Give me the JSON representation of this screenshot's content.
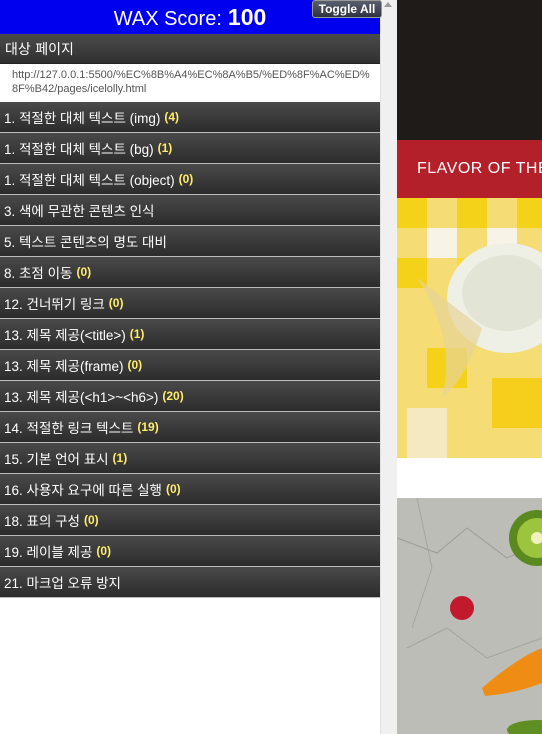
{
  "header": {
    "title": "WAX Score:",
    "score": "100"
  },
  "toggle_label": "Toggle All",
  "target": {
    "label": "대상 페이지",
    "url": "http://127.0.0.1:5500/%EC%8B%A4%EC%8A%B5/%ED%8F%AC%ED%8F%B42/pages/icelolly.html"
  },
  "items": [
    {
      "label": "1. 적절한 대체 텍스트 (img)",
      "count": "(4)"
    },
    {
      "label": "1. 적절한 대체 텍스트 (bg)",
      "count": "(1)"
    },
    {
      "label": "1. 적절한 대체 텍스트 (object)",
      "count": "(0)"
    },
    {
      "label": "3. 색에 무관한 콘텐츠 인식",
      "count": ""
    },
    {
      "label": "5. 텍스트 콘텐츠의 명도 대비",
      "count": ""
    },
    {
      "label": "8. 초점 이동",
      "count": "(0)"
    },
    {
      "label": "12. 건너뛰기 링크",
      "count": "(0)"
    },
    {
      "label": "13. 제목 제공(<title>)",
      "count": "(1)"
    },
    {
      "label": "13. 제목 제공(frame)",
      "count": "(0)"
    },
    {
      "label": "13. 제목 제공(<h1>~<h6>)",
      "count": "(20)"
    },
    {
      "label": "14. 적절한 링크 텍스트",
      "count": "(19)"
    },
    {
      "label": "15. 기본 언어 표시",
      "count": "(1)"
    },
    {
      "label": "16. 사용자 요구에 따른 실행",
      "count": "(0)"
    },
    {
      "label": "18. 표의 구성",
      "count": "(0)"
    },
    {
      "label": "19. 레이블 제공",
      "count": "(0)"
    },
    {
      "label": "21. 마크업 오류 방지",
      "count": ""
    }
  ],
  "site": {
    "banner_text": "FLAVOR OF THE"
  },
  "colors": {
    "header_bg": "#0000ee",
    "item_bg": "#3a3a3a",
    "count_color": "#ffec6b",
    "banner_red": "#b3202a"
  }
}
